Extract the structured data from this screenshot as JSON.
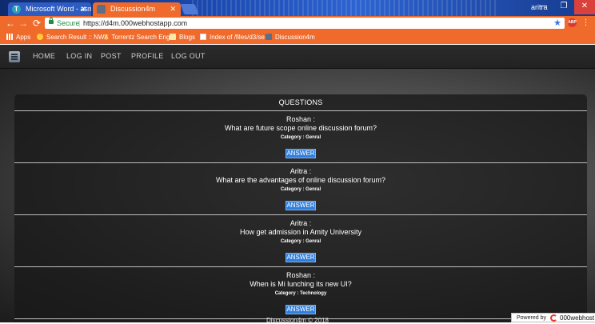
{
  "browser": {
    "tabs": [
      {
        "label": "Microsoft Word - asme_",
        "icon": "word-tab-icon"
      },
      {
        "label": "Discussion4m",
        "icon": "site-tab-icon",
        "active": true
      }
    ],
    "profile": "aritra",
    "secure_label": "Secure",
    "url": "https://d4m.000webhostapp.com",
    "bookmarks": [
      {
        "label": "Apps",
        "icon": "apps-grid-icon"
      },
      {
        "label": "Search Result :: NWA",
        "icon": "bookmark-icon"
      },
      {
        "label": "Torrentz Search Engi",
        "icon": "torrentz-icon"
      },
      {
        "label": "Blogs",
        "icon": "folder-icon"
      },
      {
        "label": "Index of /files/d3/se",
        "icon": "page-icon"
      },
      {
        "label": "Discussion4m",
        "icon": "site-icon"
      }
    ],
    "accent_color": "#f06b2b"
  },
  "site_nav": {
    "items": [
      "HOME",
      "LOG IN",
      "POST",
      "PROFILE",
      "LOG OUT"
    ]
  },
  "questions_panel": {
    "header": "QUESTIONS",
    "items": [
      {
        "author": "Roshan :",
        "question": "What are future scope online discussion forum?",
        "category": "Category : Genral",
        "button": "ANSWER"
      },
      {
        "author": "Aritra :",
        "question": "What are the advantages of online discussion forum?",
        "category": "Category : Genral",
        "button": "ANSWER"
      },
      {
        "author": "Aritra :",
        "question": "How get admission in Amity University",
        "category": "Category : Genral",
        "button": "ANSWER"
      },
      {
        "author": "Roshan :",
        "question": "When is Mi lunching its new UI?",
        "category": "Category : Technology",
        "button": "ANSWER"
      }
    ],
    "button_color": "#2f7fe0"
  },
  "footer": {
    "text": "Discussion4m © 2018",
    "powered_label": "Powered by",
    "powered_brand": "000webhost"
  }
}
